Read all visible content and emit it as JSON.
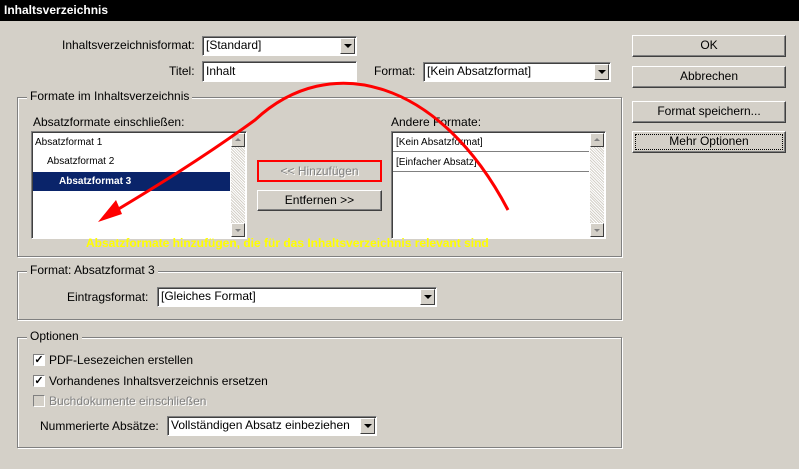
{
  "window": {
    "title": "Inhaltsverzeichnis"
  },
  "top": {
    "toc_format_label": "Inhaltsverzeichnisformat:",
    "toc_format_value": "[Standard]",
    "title_label": "Titel:",
    "title_value": "Inhalt",
    "format_label": "Format:",
    "format_value": "[Kein Absatzformat]"
  },
  "buttons": {
    "ok": "OK",
    "cancel": "Abbrechen",
    "save_format": "Format speichern...",
    "more_options": "Mehr Optionen"
  },
  "formats_group": {
    "title": "Formate im Inhaltsverzeichnis",
    "include_label": "Absatzformate einschließen:",
    "include_items": [
      "Absatzformat 1",
      "Absatzformat 2",
      "Absatzformat 3"
    ],
    "selected_item": "Absatzformat 3",
    "add_button": "<< Hinzufügen",
    "remove_button": "Entfernen >>",
    "other_label": "Andere Formate:",
    "other_items": [
      "[Kein Absatzformat]",
      "[Einfacher Absatz]"
    ],
    "annotation": "Absatzformate hinzufügen, die für das Inhaltsverzeichnis relevant sind"
  },
  "style_group": {
    "title": "Format: Absatzformat 3",
    "entry_label": "Eintragsformat:",
    "entry_value": "[Gleiches Format]"
  },
  "options_group": {
    "title": "Optionen",
    "pdf_bookmarks": "PDF-Lesezeichen erstellen",
    "pdf_bookmarks_checked": true,
    "replace_existing": "Vorhandenes Inhaltsverzeichnis ersetzen",
    "replace_existing_checked": true,
    "include_book": "Buchdokumente einschließen",
    "include_book_checked": false,
    "numbered_label": "Nummerierte Absätze:",
    "numbered_value": "Vollständigen Absatz einbeziehen"
  },
  "colors": {
    "annotation_red": "#ff0000",
    "annotation_yellow": "#ffff00",
    "selection": "#0a246a"
  }
}
